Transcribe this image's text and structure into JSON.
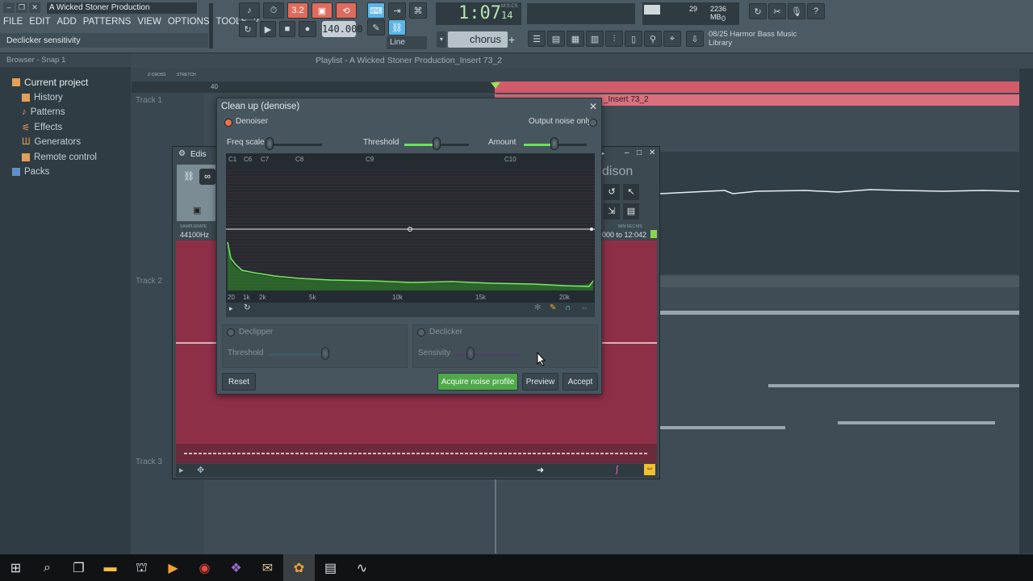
{
  "app": {
    "title": "A Wicked Stoner Production",
    "hint": "Declicker sensitivity",
    "menu": [
      "FILE",
      "EDIT",
      "ADD",
      "PATTERNS",
      "VIEW",
      "OPTIONS",
      "TOOLS",
      "?"
    ]
  },
  "transport": {
    "time_main": "1:07",
    "time_sub": "14",
    "time_unit": "M:S:CS",
    "tempo": "140.000",
    "pattern": "chorus",
    "snap_mode": "Line",
    "record_label": "3.2"
  },
  "cpu": {
    "value": "29",
    "memory": "2236 MB",
    "polyphony": "0"
  },
  "news": {
    "line1": "08/25  Harmor Bass Music",
    "line2": "Library"
  },
  "browser": {
    "header": "Browser - Snap 1",
    "items": [
      {
        "label": "Current project"
      },
      {
        "label": "History"
      },
      {
        "label": "Patterns"
      },
      {
        "label": "Effects"
      },
      {
        "label": "Generators"
      },
      {
        "label": "Remote control"
      },
      {
        "label": "Packs"
      }
    ]
  },
  "playlist": {
    "title": "Playlist - A Wicked Stoner Production_Insert 73_2",
    "clip_name": "_Insert 73_2",
    "tracks": [
      "Track 1",
      "Track 2",
      "Track 3"
    ],
    "ruler_mark": "40",
    "tool_labels": [
      "Z-CROSS",
      "STRETCH"
    ]
  },
  "edison": {
    "title": "Edis",
    "samplerate_label": "SAMPLERATE",
    "samplerate": "44100Hz",
    "brand": "dison",
    "range_label": "MIN:SEC:MS",
    "range": "000 to 12:042"
  },
  "dialog": {
    "title": "Clean up (denoise)",
    "denoiser_label": "Denoiser",
    "output_noise_label": "Output noise only",
    "freq_scale_label": "Freq scale",
    "threshold_label": "Threshold",
    "amount_label": "Amount",
    "note_labels": [
      "C1",
      "C6",
      "C7",
      "C8",
      "C9",
      "C10"
    ],
    "freq_labels": [
      "20",
      "1k",
      "2k",
      "5k",
      "10k",
      "15k",
      "20k"
    ],
    "declipper_label": "Declipper",
    "declipper_threshold_label": "Threshold",
    "declicker_label": "Declicker",
    "declicker_sensivity_label": "Sensivity",
    "reset_label": "Reset",
    "acquire_label": "Acquire noise profile",
    "preview_label": "Preview",
    "accept_label": "Accept",
    "freq_scale_level": 0.05,
    "threshold_level": 0.5,
    "amount_level": 0.5
  },
  "colors": {
    "accent_green": "#6ce05f",
    "clip_red": "#d25a6b",
    "wave_red": "#8e2f48"
  }
}
